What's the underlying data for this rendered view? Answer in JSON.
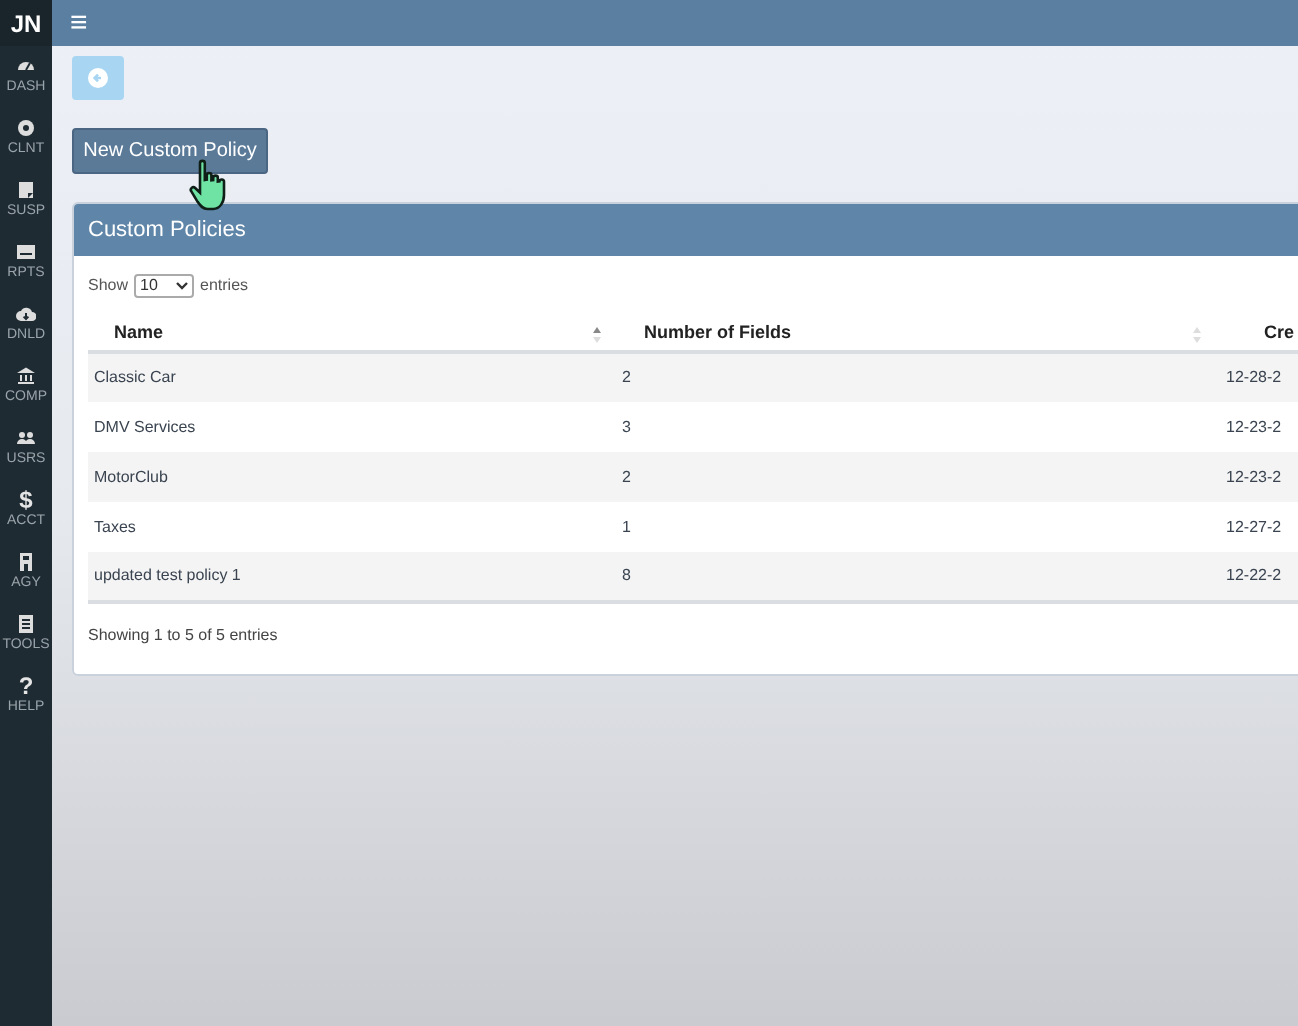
{
  "sidebar": {
    "brand": "JN",
    "items": [
      {
        "label": "DASH"
      },
      {
        "label": "CLNT"
      },
      {
        "label": "SUSP"
      },
      {
        "label": "RPTS"
      },
      {
        "label": "DNLD"
      },
      {
        "label": "COMP"
      },
      {
        "label": "USRS"
      },
      {
        "label": "ACCT",
        "glyph": "$"
      },
      {
        "label": "AGY"
      },
      {
        "label": "TOOLS"
      },
      {
        "label": "HELP",
        "glyph": "?"
      }
    ]
  },
  "top_bar": {
    "menu_glyph": "≡"
  },
  "new_button": "New Custom Policy",
  "panel": {
    "title": "Custom Policies",
    "length": {
      "before": "Show",
      "value": "10",
      "after": "entries"
    },
    "table": {
      "columns": [
        "Name",
        "Number of Fields",
        "Cre"
      ],
      "rows": [
        [
          "Classic Car",
          "2",
          "12-28-2"
        ],
        [
          "DMV Services",
          "3",
          "12-23-2"
        ],
        [
          "MotorClub",
          "2",
          "12-23-2"
        ],
        [
          "Taxes",
          "1",
          "12-27-2"
        ],
        [
          "updated test policy 1",
          "8",
          "12-22-2"
        ]
      ]
    },
    "info": "Showing 1 to 5 of 5 entries"
  }
}
